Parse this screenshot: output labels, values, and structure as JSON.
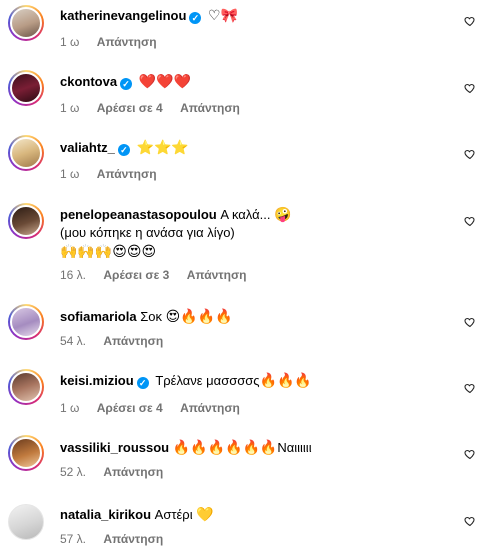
{
  "reply_label": "Απάντηση",
  "comments": [
    {
      "user": "katherinevangelinou",
      "verified": true,
      "text": "",
      "emoji": "♡🎀",
      "time": "1 ω",
      "likes": ""
    },
    {
      "user": "ckontova",
      "verified": true,
      "text": "",
      "emoji": "❤️❤️❤️",
      "time": "1 ω",
      "likes": "Αρέσει σε 4"
    },
    {
      "user": "valiahtz_",
      "verified": true,
      "text": "",
      "emoji": "⭐⭐⭐",
      "time": "1 ω",
      "likes": ""
    },
    {
      "user": "penelopeanastasopoulou",
      "verified": false,
      "text": "Α καλά...",
      "emoji": "🤪",
      "line2": "(μου κόπηκε η ανάσα για λίγο)",
      "line3": "🙌🙌🙌😍😍😍",
      "time": "16 λ.",
      "likes": "Αρέσει σε 3"
    },
    {
      "user": "sofiamariola",
      "verified": false,
      "text": "Σοκ",
      "emoji": "😍🔥🔥🔥",
      "time": "54 λ.",
      "likes": ""
    },
    {
      "user": "keisi.miziou",
      "verified": true,
      "text": "Τρέλανε μασσσσς",
      "emoji": "🔥🔥🔥",
      "time": "1 ω",
      "likes": "Αρέσει σε 4"
    },
    {
      "user": "vassiliki_roussou",
      "verified": false,
      "text": "Ναιιιιιι",
      "emoji": "🔥🔥🔥🔥🔥🔥",
      "time": "52 λ.",
      "likes": ""
    },
    {
      "user": "natalia_kirikou",
      "verified": false,
      "text": "Αστέρι",
      "emoji": "💛",
      "time": "57 λ.",
      "likes": ""
    }
  ],
  "colors": {
    "verified": "#0095f6",
    "muted": "#737373"
  }
}
